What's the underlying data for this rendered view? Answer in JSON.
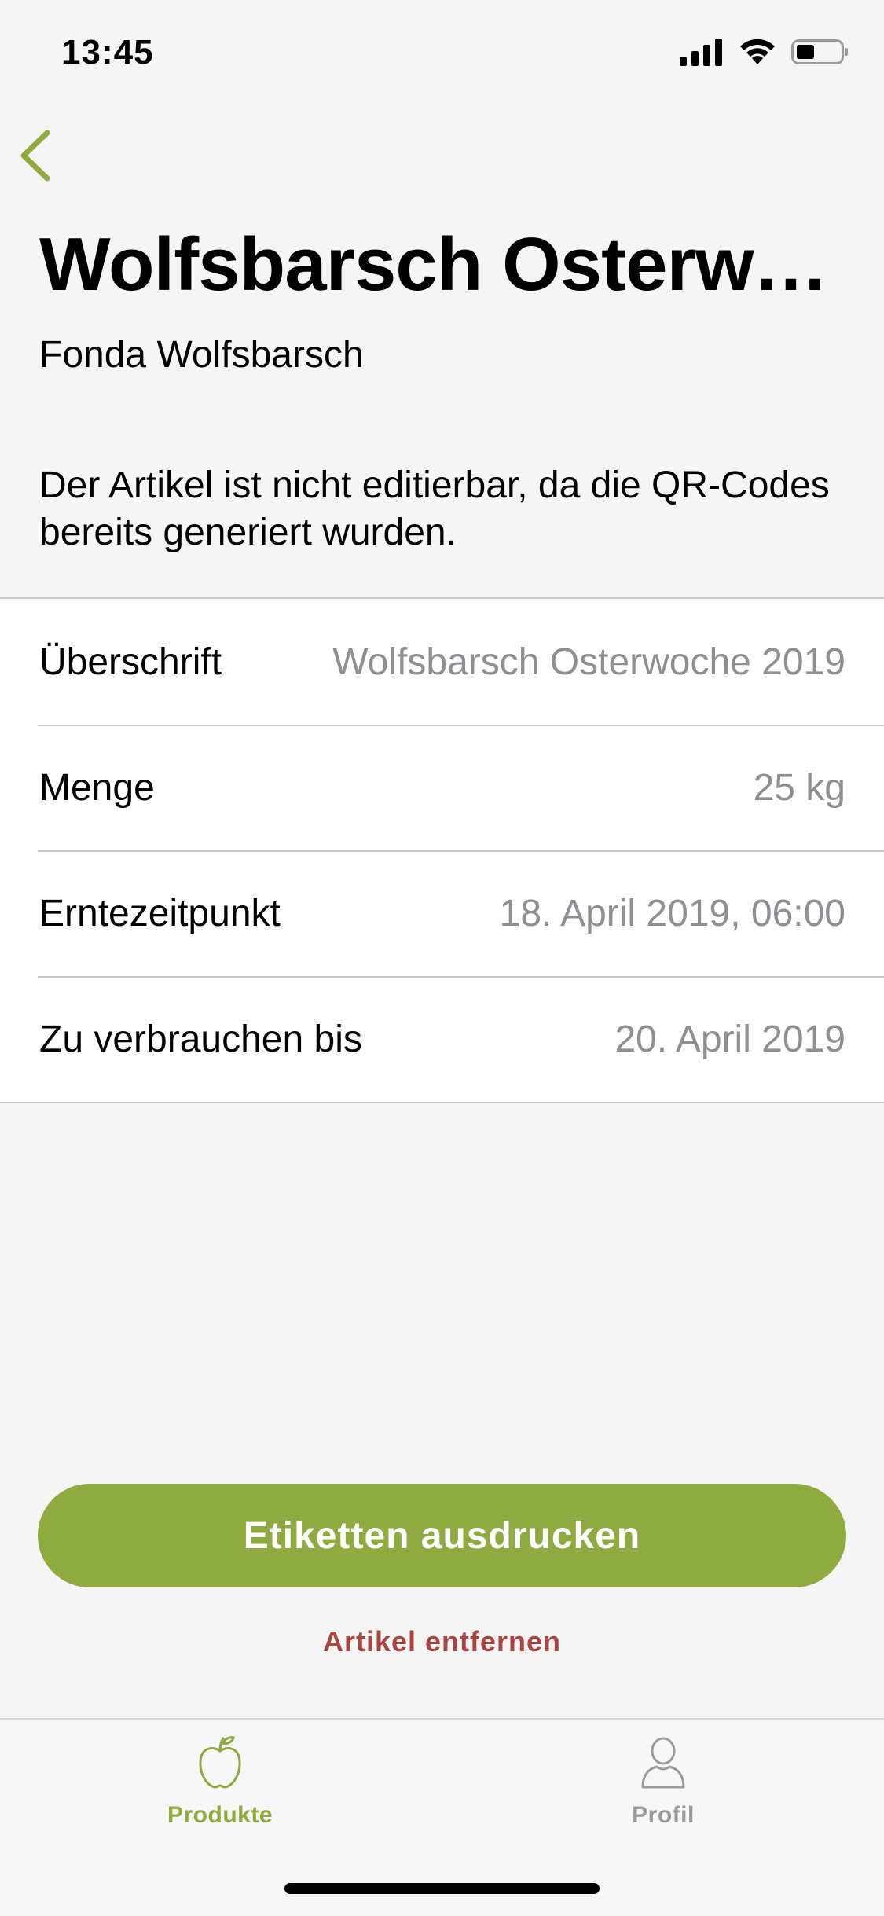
{
  "status_bar": {
    "time": "13:45"
  },
  "header": {
    "title": "Wolfsbarsch Osterwoche 2019",
    "subtitle": "Fonda Wolfsbarsch"
  },
  "info": {
    "text": "Der Artikel ist nicht editierbar, da die QR-Codes bereits generiert wurden."
  },
  "details": [
    {
      "label": "Überschrift",
      "value": "Wolfsbarsch Osterwoche 2019"
    },
    {
      "label": "Menge",
      "value": "25 kg"
    },
    {
      "label": "Erntezeitpunkt",
      "value": "18. April 2019, 06:00"
    },
    {
      "label": "Zu verbrauchen bis",
      "value": "20. April 2019"
    }
  ],
  "actions": {
    "print_label": "Etiketten ausdrucken",
    "remove_label": "Artikel entfernen"
  },
  "tab_bar": {
    "items": [
      {
        "label": "Produkte",
        "icon": "apple-icon",
        "active": true
      },
      {
        "label": "Profil",
        "icon": "person-icon",
        "active": false
      }
    ]
  },
  "colors": {
    "accent": "#8faa3e",
    "destructive": "#a94440",
    "secondary_text": "#8e8e93",
    "background": "#f5f5f5"
  }
}
